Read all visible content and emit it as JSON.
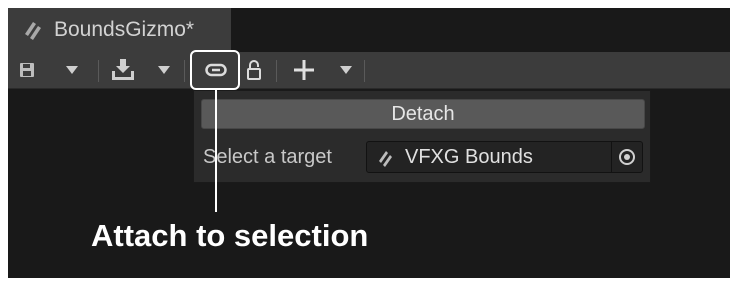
{
  "window": {
    "tab_title": "BoundsGizmo*"
  },
  "toolbar": {
    "icons": [
      "save-icon",
      "dropdown-arrow-icon",
      "import-icon",
      "dropdown-arrow-icon",
      "link-icon",
      "lock-icon",
      "plus-icon",
      "dropdown-arrow-icon"
    ]
  },
  "popup": {
    "detach_label": "Detach",
    "target_label": "Select a target",
    "target_value": "VFXG Bounds"
  },
  "annotation": {
    "caption": "Attach to selection"
  },
  "colors": {
    "background": "#191919",
    "toolbar": "#3c3c3c",
    "panel": "#2b2b2b",
    "button": "#595959",
    "highlight": "#ffffff"
  }
}
